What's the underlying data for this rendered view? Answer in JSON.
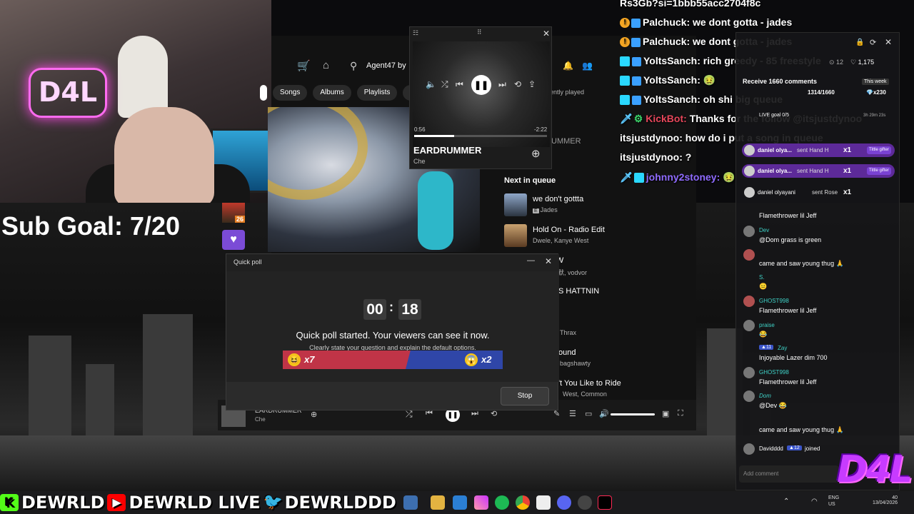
{
  "webcam": {
    "neon_sign": "D4L",
    "sub_goal": "Sub Goal: 7/20"
  },
  "side_strip": {
    "badge": "26"
  },
  "spotify": {
    "search_value": "Agent47 by",
    "tabs": [
      "Songs",
      "Albums",
      "Playlists",
      "Art"
    ],
    "recently_played_label": "ently played",
    "now_playing_side_title": "UMMER",
    "next_in_queue_label": "Next in queue",
    "queue": [
      {
        "title": "we don't gottta",
        "artist": "Jades",
        "explicit": "E"
      },
      {
        "title": "Hold On - Radio Edit",
        "artist": "Dwele, Kanye West",
        "explicit": ""
      },
      {
        "title": "AW",
        "artist": "生默, vodvor",
        "explicit": ""
      },
      {
        "title": "S HATTNIN",
        "artist": "",
        "explicit": ""
      },
      {
        "title": "",
        "artist": "Thrax",
        "explicit": ""
      },
      {
        "title": "ound",
        "artist": "bagshawty",
        "explicit": ""
      },
      {
        "title": "'t You Like to Ride",
        "artist": "West, Common",
        "explicit": ""
      }
    ],
    "player_bar": {
      "title": "EARDRUMMER",
      "artist": "Che"
    }
  },
  "mini_player": {
    "title": "EARDRUMMER",
    "artist": "Che",
    "elapsed": "0:56",
    "remaining": "-2:22",
    "progress": 0.3
  },
  "poll": {
    "window_title": "Quick poll",
    "minutes": "00",
    "seconds": "18",
    "headline": "Quick poll started. Your viewers can see it now.",
    "subline": "Clearly state your question and explain the default options.",
    "left_count": "x7",
    "right_count": "x2",
    "stop_label": "Stop"
  },
  "chat": [
    {
      "prefix": "",
      "name": "",
      "text": "Rs3Gb?si=1bbb55acc2704f8c",
      "icons": ""
    },
    {
      "prefix": "bang-cube",
      "name": "Palchuck:",
      "text": "we dont gotta - jades"
    },
    {
      "prefix": "bang-cube",
      "name": "Palchuck:",
      "text": "we dont gotta - jades"
    },
    {
      "prefix": "grid-cube",
      "name": "YoltsSanch:",
      "text": "rich greedy - 85 freestyle"
    },
    {
      "prefix": "grid-cube",
      "name": "YoltsSanch:",
      "text": "🤢"
    },
    {
      "prefix": "grid-cube",
      "name": "YoltsSanch:",
      "text": "oh shi big queue"
    },
    {
      "prefix": "sword-gear",
      "name": "KickBot:",
      "text": "Thanks for the follow @itsjustdynoo"
    },
    {
      "prefix": "",
      "name": "itsjustdynoo:",
      "text": "how do i put a song in queue"
    },
    {
      "prefix": "",
      "name": "itsjustdynoo:",
      "text": "?"
    },
    {
      "prefix": "sword-grid",
      "name": "johnny2stoney:",
      "text": "🤢"
    }
  ],
  "tiktok": {
    "stats_likes": "12",
    "stats_hearts": "1,175",
    "goal_title": "Receive 1660 comments",
    "goal_period": "This week",
    "goal_progress": "1314/1660",
    "goal_reward": "x230",
    "live_goal": "LIVE goal 0/5",
    "live_timer": "3h 29m 23s",
    "gifts": [
      {
        "name": "daniel olya...",
        "text": "sent Hand H",
        "count": "x1",
        "tag": "Tittle gifter"
      },
      {
        "name": "daniel olya...",
        "text": "sent Hand H",
        "count": "x1",
        "tag": "Tittle gifter"
      }
    ],
    "rose_line": {
      "name": "daniel olyayani",
      "text": "sent Rose",
      "count": "x1"
    },
    "comments": [
      {
        "name": "",
        "text": "Flamethrower lil Jeff"
      },
      {
        "name": "Dev",
        "text": "@Dom grass is green"
      },
      {
        "name": "",
        "text": "came and saw young thug 🙏"
      },
      {
        "name": "S.",
        "text": "😐"
      },
      {
        "name": "GHOST998",
        "text": "Flamethrower lil Jeff"
      },
      {
        "name": "praise",
        "text": "😂"
      },
      {
        "name": "Zay",
        "text": "Injoyable Lazer dim 700",
        "level": "11"
      },
      {
        "name": "GHOST998",
        "text": "Flamethrower lil Jeff"
      },
      {
        "name": "Dom",
        "text": "@Dev 😂"
      },
      {
        "name": "",
        "text": "came and saw young thug 🙏"
      },
      {
        "name": "Davidddd",
        "text": "joined",
        "level": "12"
      }
    ],
    "add_comment_placeholder": "Add comment"
  },
  "overlay_logo": "D4L",
  "socials": {
    "kick": "DEWRLD",
    "youtube": "DEWRLD LIVE",
    "twitter": "DEWRLDDD"
  },
  "taskbar": {
    "lang": "ENG",
    "region": "US",
    "time": "40",
    "date": "13/04/2026"
  },
  "colors": {
    "poll_left": "#c03447",
    "poll_right": "#2f46a8",
    "gift_bg": "#5d2a99",
    "neon": "#ff6bf0"
  }
}
